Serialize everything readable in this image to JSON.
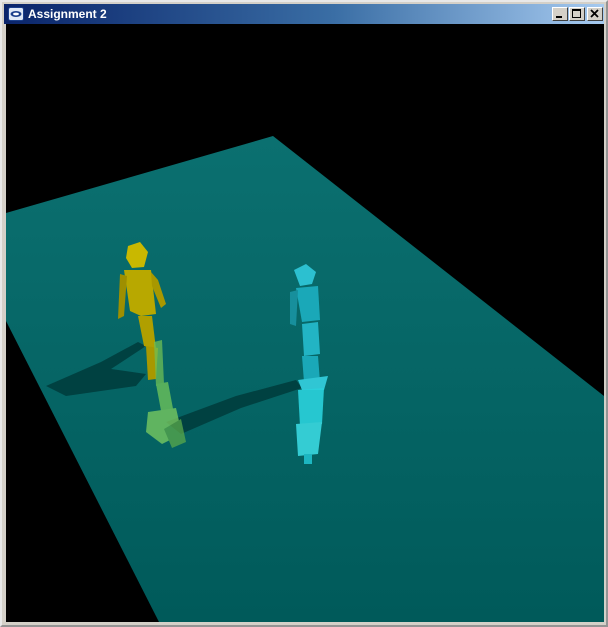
{
  "window": {
    "title": "Assignment 2",
    "controls": {
      "minimize": "minimize",
      "maximize": "maximize",
      "close": "close"
    }
  },
  "scene": {
    "background_color": "#000000",
    "floor_color": "#006666",
    "figures": [
      {
        "name": "yellow-figure",
        "color": "#b8a800"
      },
      {
        "name": "cyan-figure",
        "color": "#1fb8c8"
      }
    ]
  }
}
